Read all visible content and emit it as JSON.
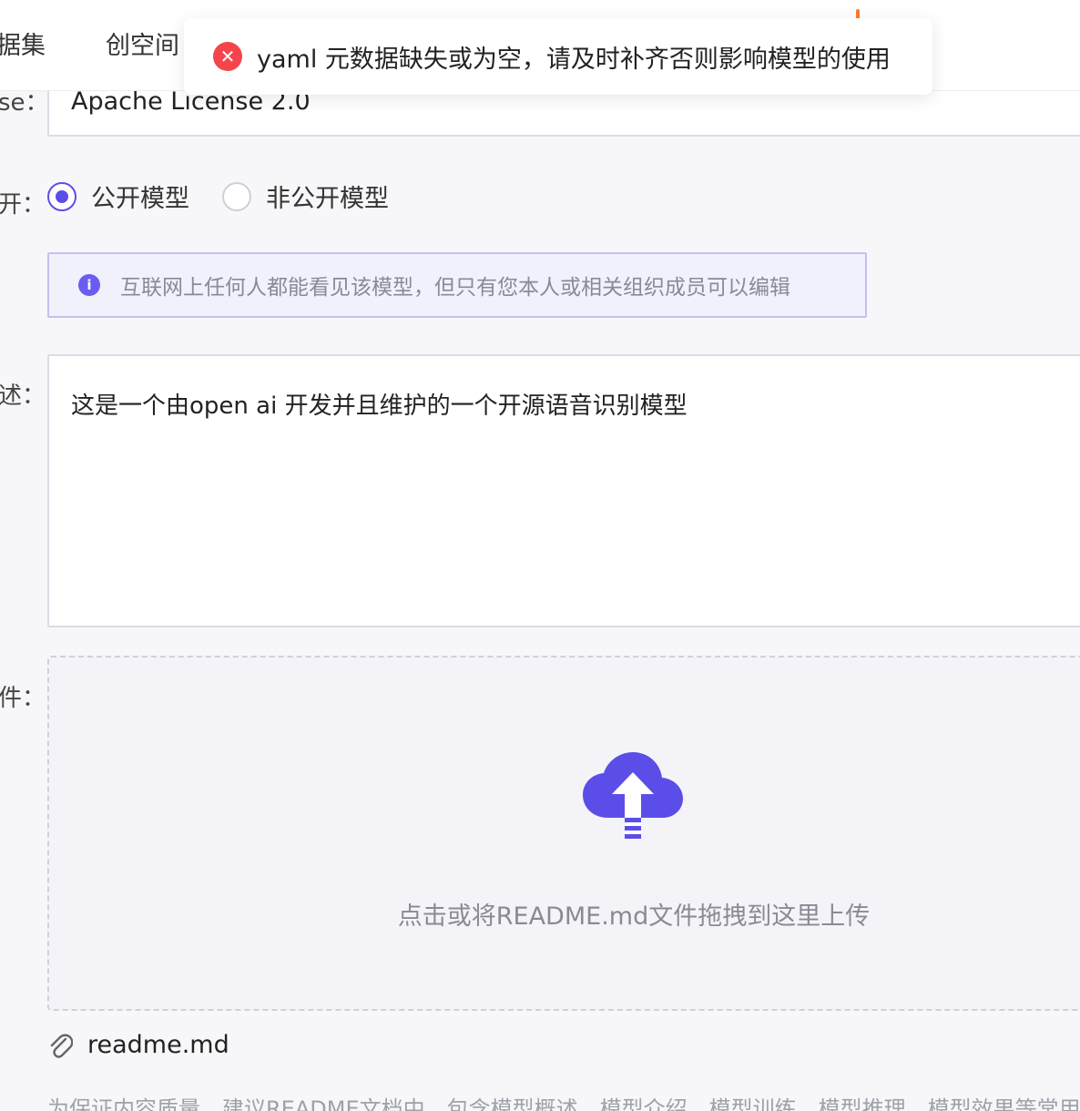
{
  "nav": {
    "datasets": "据集",
    "spaces": "创空间"
  },
  "toast": {
    "icon": "error-icon",
    "message": "yaml 元数据缺失或为空，请及时补齐否则影响模型的使用"
  },
  "form": {
    "license": {
      "label": "se：",
      "value": "Apache License 2.0"
    },
    "visibility": {
      "label": "开：",
      "options": [
        {
          "label": "公开模型",
          "checked": true
        },
        {
          "label": "非公开模型",
          "checked": false
        }
      ],
      "info": "互联网上任何人都能看见该模型，但只有您本人或相关组织成员可以编辑"
    },
    "description": {
      "label": "述：",
      "value": "这是一个由open ai 开发并且维护的一个开源语音识别模型"
    },
    "readme": {
      "label": "件：",
      "dropzone_text": "点击或将README.md文件拖拽到这里上传",
      "attached_file": "readme.md"
    },
    "hint": "为保证内容质量，建议README文档中，包含模型概述、模型介绍、模型训练、模型推理、模型效果等常用"
  },
  "colors": {
    "accent": "#5b4ee8",
    "error": "#f5454a"
  }
}
